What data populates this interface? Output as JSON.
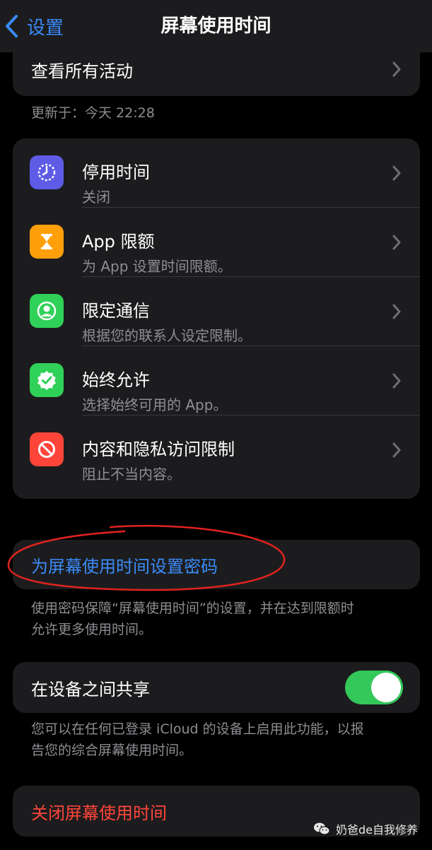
{
  "nav": {
    "back_label": "设置",
    "title": "屏幕使用时间"
  },
  "top_item": {
    "label": "查看所有活动"
  },
  "updated": {
    "text": "更新于：今天 22:28"
  },
  "features": [
    {
      "title": "停用时间",
      "subtitle": "关闭",
      "icon": "downtime-icon",
      "color": "#5e5ce6"
    },
    {
      "title": "App 限额",
      "subtitle": "为 App 设置时间限额。",
      "icon": "hourglass-icon",
      "color": "#ff9f0a"
    },
    {
      "title": "限定通信",
      "subtitle": "根据您的联系人设定限制。",
      "icon": "contact-icon",
      "color": "#30d158"
    },
    {
      "title": "始终允许",
      "subtitle": "选择始终可用的 App。",
      "icon": "checkmark-badge-icon",
      "color": "#30d158"
    },
    {
      "title": "内容和隐私访问限制",
      "subtitle": "阻止不当内容。",
      "icon": "no-entry-icon",
      "color": "#ff453a"
    }
  ],
  "passcode": {
    "label": "为屏幕使用时间设置密码",
    "footnote_line1": "使用密码保障“屏幕使用时间”的设置，并在达到限额时",
    "footnote_line2": "允许更多使用时间。"
  },
  "share": {
    "label": "在设备之间共享",
    "toggle_on": true,
    "footnote_line1": "您可以在任何已登录 iCloud 的设备上启用此功能，以报",
    "footnote_line2": "告您的综合屏幕使用时间。"
  },
  "turn_off": {
    "label": "关闭屏幕使用时间"
  },
  "watermark": {
    "text": "奶爸de自我修养"
  },
  "colors": {
    "accent": "#3b8bf7",
    "danger": "#ff453a",
    "toggle": "#34c759",
    "annotation": "#e0231f"
  }
}
